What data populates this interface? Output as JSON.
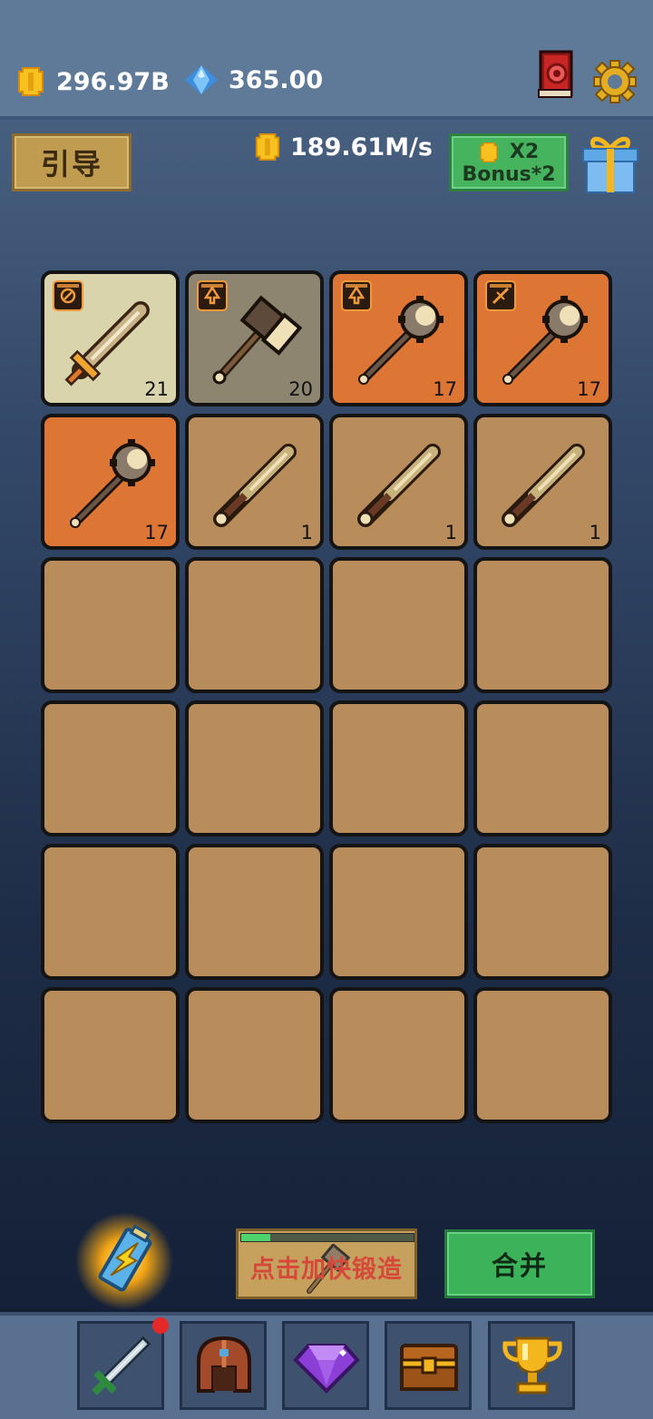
{
  "currencies": {
    "gold": "296.97B",
    "gems": "365.00"
  },
  "guide_button": "引导",
  "income_rate": "189.61M/s",
  "bonus_button": {
    "multiplier": "X2",
    "label": "Bonus*2"
  },
  "grid": {
    "rows": [
      [
        {
          "color": "#d9d4ac",
          "weapon": "sword",
          "level": "21",
          "badge": "compass-icon"
        },
        {
          "color": "#8d8570",
          "weapon": "hammer",
          "level": "20",
          "badge": "spade-icon"
        },
        {
          "color": "#dd7534",
          "weapon": "mace",
          "level": "17",
          "badge": "spade-icon"
        },
        {
          "color": "#dd7534",
          "weapon": "mace",
          "level": "17",
          "badge": "slash-icon"
        }
      ],
      [
        {
          "color": "#dd7534",
          "weapon": "mace",
          "level": "17"
        },
        {
          "color": "#b88c5b",
          "weapon": "dagger",
          "level": "1"
        },
        {
          "color": "#b88c5b",
          "weapon": "dagger",
          "level": "1"
        },
        {
          "color": "#b88c5b",
          "weapon": "dagger",
          "level": "1"
        }
      ]
    ],
    "empty_color": "#b88c5b"
  },
  "forge_button": {
    "label": "点击加快锻造",
    "progress": 0.17
  },
  "merge_button": "合并",
  "bottom_nav": [
    {
      "name": "sword-icon",
      "badge": true
    },
    {
      "name": "helmet-icon",
      "badge": false
    },
    {
      "name": "gem-icon",
      "badge": false
    },
    {
      "name": "chest-icon",
      "badge": false
    },
    {
      "name": "trophy-icon",
      "badge": false
    }
  ]
}
